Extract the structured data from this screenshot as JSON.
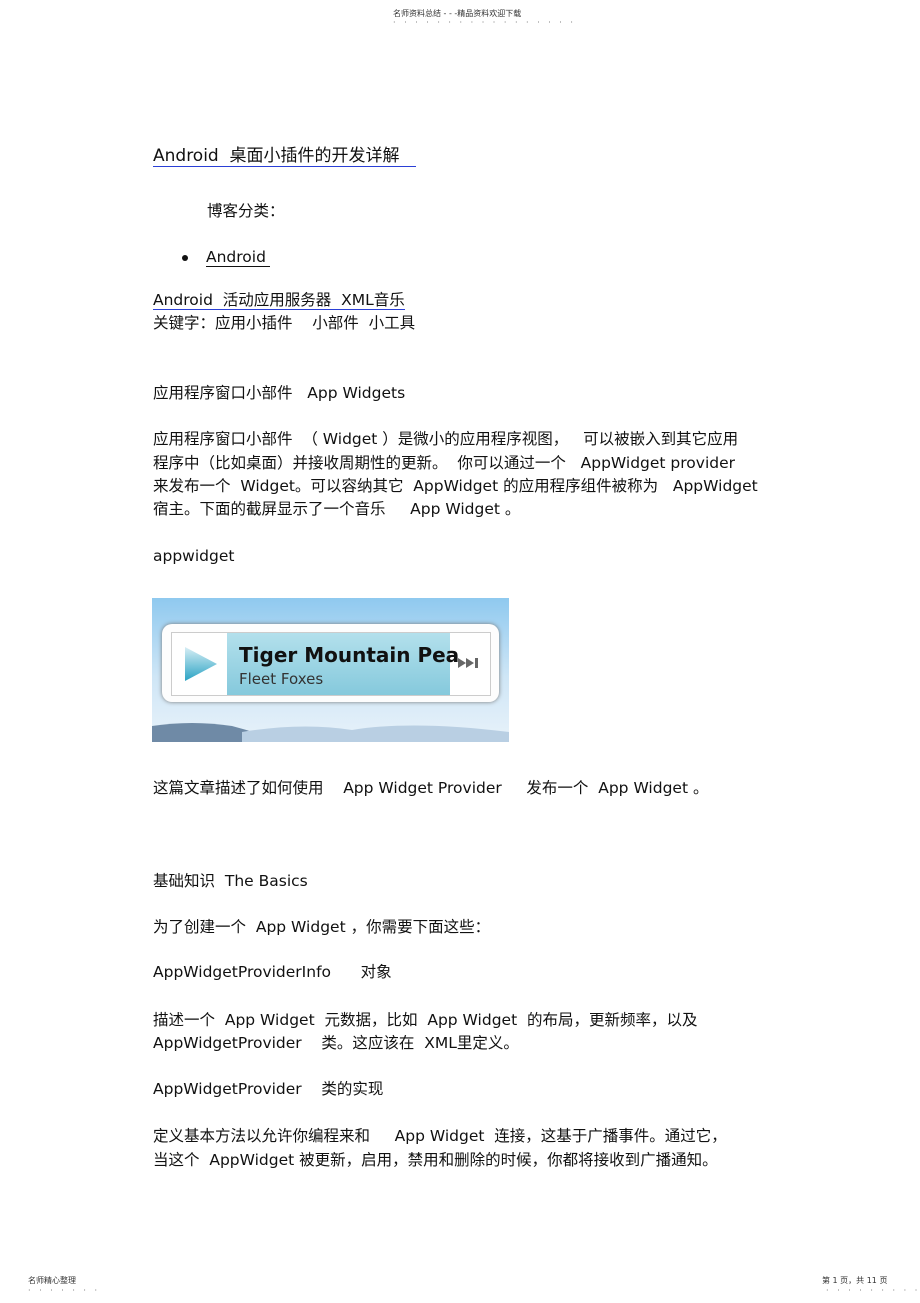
{
  "header": {
    "text": "名师资料总结 - - -精品资料欢迎下载"
  },
  "title": "Android  桌面小插件的开发详解",
  "blog_category_label": "博客分类：",
  "category_item": "Android",
  "tags_line": "Android  活动应用服务器  XML音乐",
  "keywords": "关键字：应用小插件    小部件  小工具",
  "section1_heading": "应用程序窗口小部件   App Widgets",
  "paragraph1": [
    "应用程序窗口小部件  （ Widget ）是微小的应用程序视图，   可以被嵌入到其它应用",
    "程序中（比如桌面）并接收周期性的更新。  你可以通过一个   AppWidget provider",
    "来发布一个  Widget。可以容纳其它  AppWidget 的应用程序组件被称为   AppWidget",
    "宿主。下面的截屏显示了一个音乐     App Widget 。"
  ],
  "image_caption": "appwidget",
  "widget": {
    "track": "Tiger Mountain Pea",
    "artist": "Fleet Foxes",
    "play_icon": "play-icon",
    "next_icon": "skip-next-icon"
  },
  "paragraph2": "这篇文章描述了如何使用    App Widget Provider     发布一个  App Widget 。",
  "section2_heading": "基础知识  The Basics",
  "basics_intro": "为了创建一个  App Widget ，你需要下面这些：",
  "item1_heading": "AppWidgetProviderInfo      对象",
  "item1_desc": [
    "描述一个  App Widget  元数据，比如  App Widget  的布局，更新频率，以及",
    "AppWidgetProvider    类。这应该在  XML里定义。"
  ],
  "item2_heading": "AppWidgetProvider    类的实现",
  "item2_desc": [
    "定义基本方法以允许你编程来和     App Widget  连接，这基于广播事件。通过它，",
    "当这个  AppWidget 被更新，启用，禁用和删除的时候，你都将接收到广播通知。"
  ],
  "footer": {
    "left": "名师精心整理",
    "right": "第 1 页，共 11 页"
  }
}
